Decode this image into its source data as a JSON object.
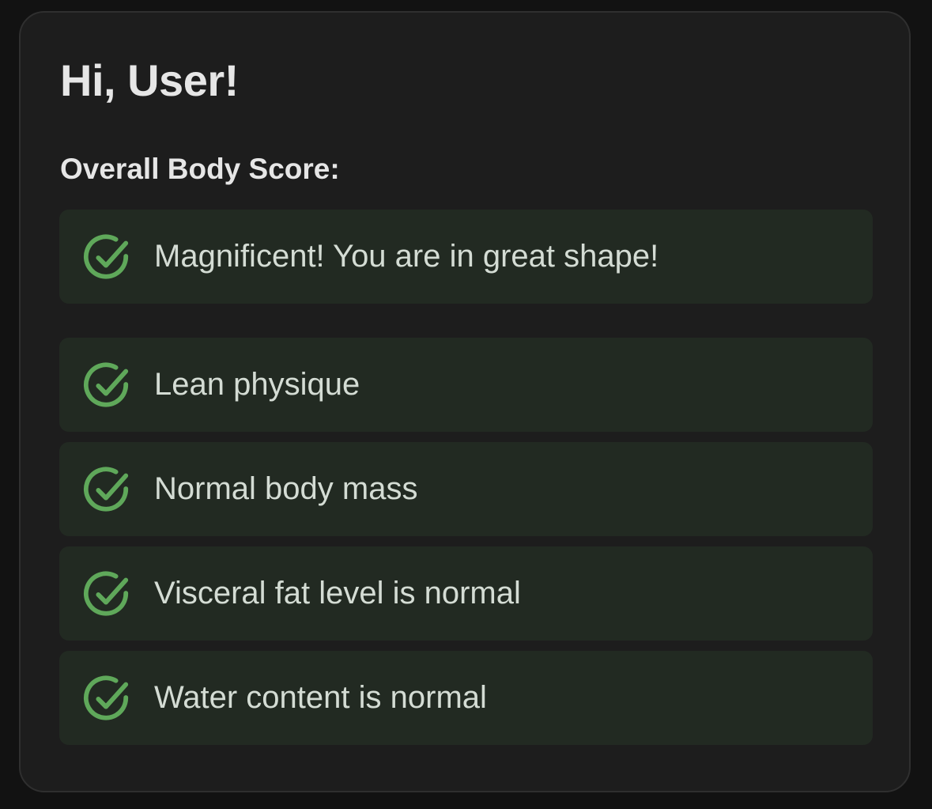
{
  "header": {
    "greeting": "Hi, User!"
  },
  "score": {
    "label": "Overall Body Score:",
    "summary": {
      "icon": "check-circle-icon",
      "text": "Magnificent! You are in great shape!"
    }
  },
  "metrics": [
    {
      "icon": "check-circle-icon",
      "text": "Lean physique"
    },
    {
      "icon": "check-circle-icon",
      "text": "Normal body mass"
    },
    {
      "icon": "check-circle-icon",
      "text": "Visceral fat level is normal"
    },
    {
      "icon": "check-circle-icon",
      "text": "Water content is normal"
    }
  ],
  "colors": {
    "accent": "#5fa85a",
    "row_background": "#222a22",
    "card_background": "#1d1d1d",
    "page_background": "#121212"
  }
}
